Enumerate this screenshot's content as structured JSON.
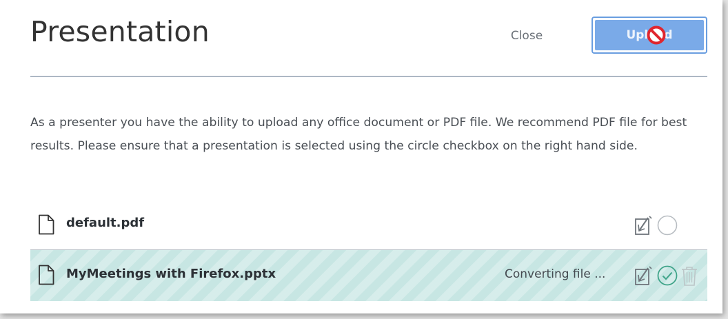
{
  "modal": {
    "title": "Presentation",
    "close_label": "Close",
    "upload_label": "Upload"
  },
  "description": "As a presenter you have the ability to upload any office document or PDF file. We recommend PDF file for best results. Please ensure that a presentation is selected using the circle checkbox on the right hand side.",
  "files": [
    {
      "name": "default.pdf",
      "status": "",
      "selected": false
    },
    {
      "name": "MyMeetings with Firefox.pptx",
      "status": "Converting file ...",
      "selected": true
    }
  ],
  "colors": {
    "upload_button": "#7aaae8",
    "upload_border": "#6a9ee0",
    "uploading_row": "#c7e6e3",
    "check_green": "#3fa489",
    "not_allowed_red": "#e0262e"
  },
  "icons": {
    "file": "file-icon",
    "allow_download": "download-toggle-icon",
    "select_current": "select-circle-icon",
    "remove": "trash-icon",
    "cursor": "not-allowed-icon"
  }
}
